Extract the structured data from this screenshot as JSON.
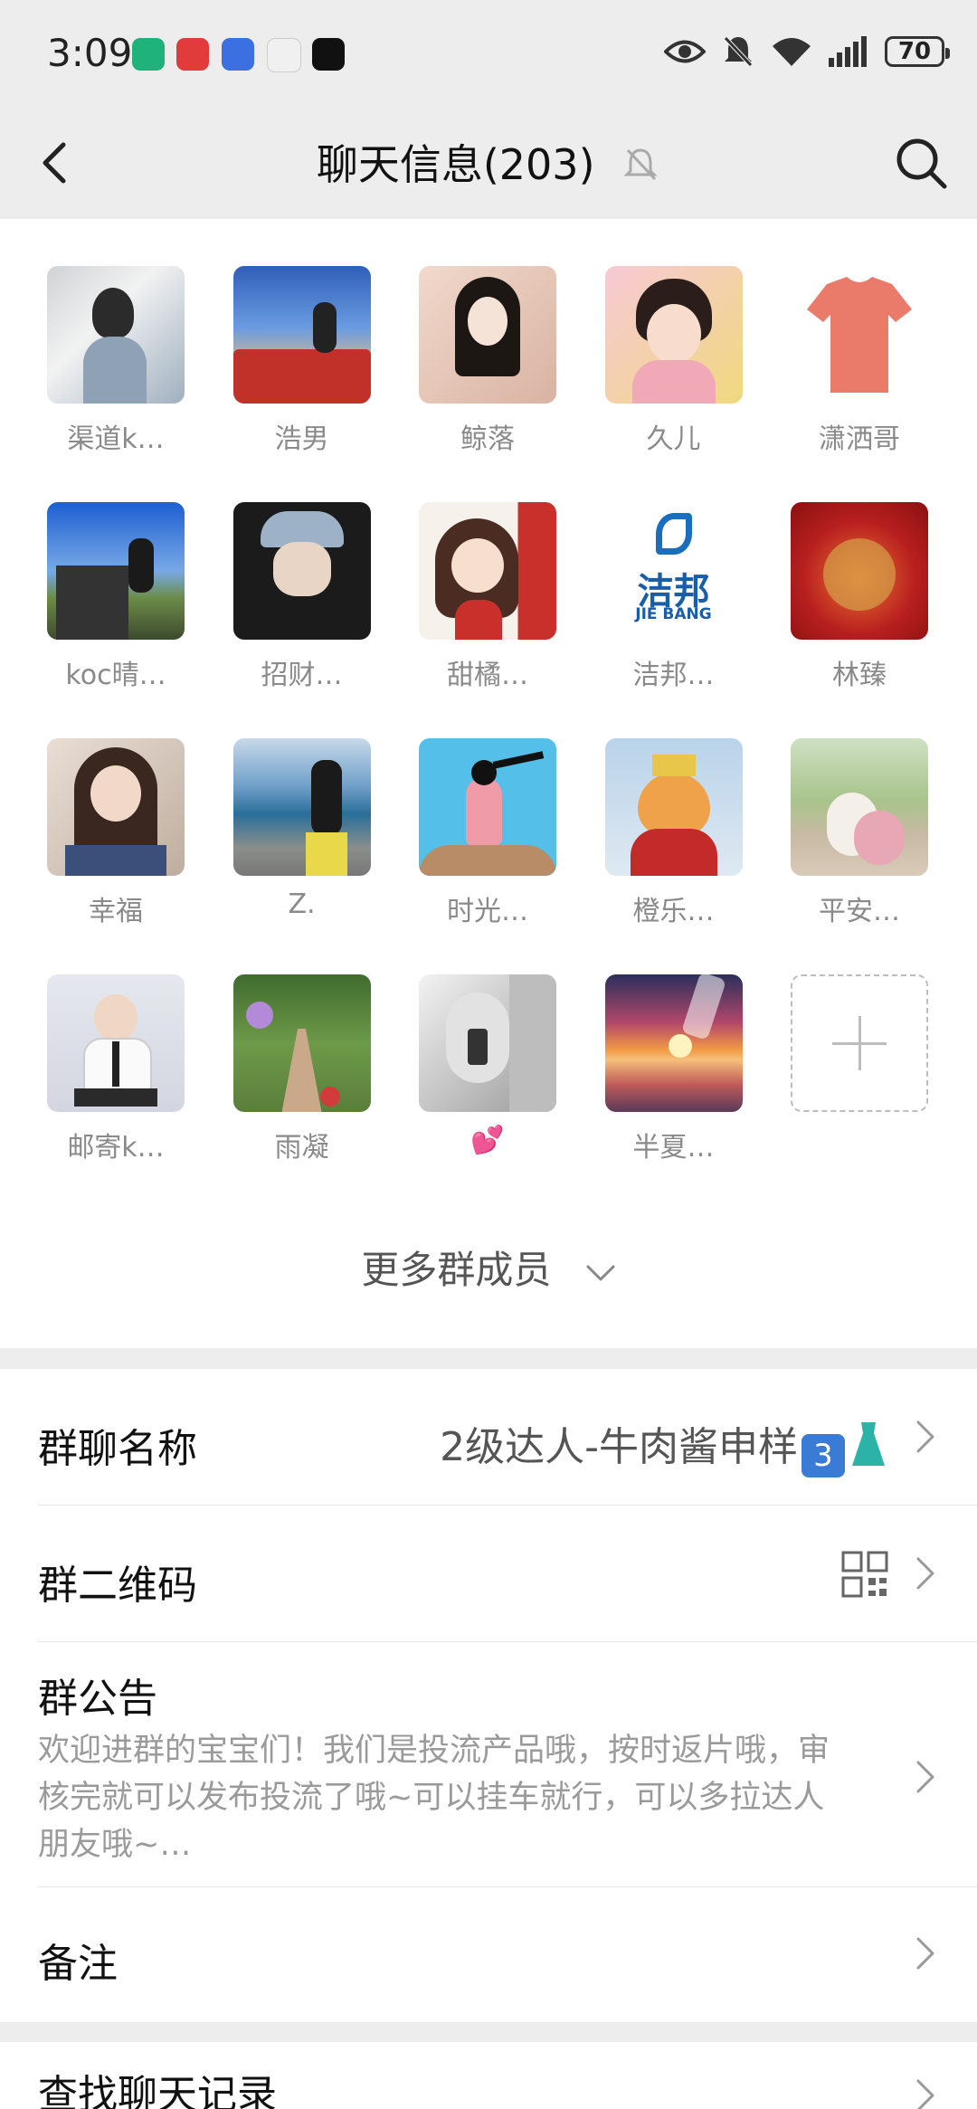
{
  "status_bar": {
    "time": "3:09",
    "battery": "70"
  },
  "header": {
    "title": "聊天信息(203)"
  },
  "members": [
    {
      "name": "渠道k…"
    },
    {
      "name": "浩男"
    },
    {
      "name": "鲸落"
    },
    {
      "name": "久儿"
    },
    {
      "name": "潇洒哥"
    },
    {
      "name": "koc晴…"
    },
    {
      "name": "招财…"
    },
    {
      "name": "甜橘…"
    },
    {
      "name": "洁邦…"
    },
    {
      "name": "林臻"
    },
    {
      "name": "幸福"
    },
    {
      "name": "Z."
    },
    {
      "name": "时光…"
    },
    {
      "name": "橙乐…"
    },
    {
      "name": "平安…"
    },
    {
      "name": "邮寄k…"
    },
    {
      "name": "雨凝"
    },
    {
      "name": "💕"
    },
    {
      "name": "半夏…"
    }
  ],
  "logo_text": {
    "brand_cn": "洁邦",
    "brand_en": "JIE BANG"
  },
  "more_members_label": "更多群成员",
  "settings": {
    "group_name_label": "群聊名称",
    "group_name_value": "2级达人-牛肉酱申样",
    "group_name_badge": "3",
    "group_qr_label": "群二维码",
    "notice_label": "群公告",
    "notice_text": "欢迎进群的宝宝们！我们是投流产品哦，按时返片哦，审核完就可以发布投流了哦~可以挂车就行，可以多拉达人朋友哦~…",
    "remark_label": "备注",
    "search_history_label": "查找聊天记录"
  }
}
